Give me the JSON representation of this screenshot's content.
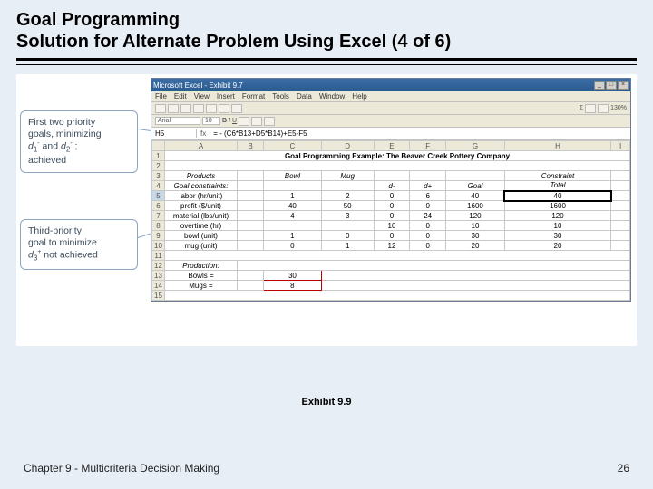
{
  "title_line1": "Goal Programming",
  "title_line2": "Solution for Alternate Problem Using Excel (4 of 6)",
  "excel": {
    "window_title": "Microsoft Excel - Exhibit 9.7",
    "menus": [
      "File",
      "Edit",
      "View",
      "Insert",
      "Format",
      "Tools",
      "Data",
      "Window",
      "Help"
    ],
    "toolbar_font": "Arial",
    "toolbar_size": "10",
    "toolbar_zoom": "130%",
    "namebox": "H5",
    "formula": "= - (C6*B13+D5*B14)+E5-F5",
    "col_headers": [
      "A",
      "B",
      "C",
      "D",
      "E",
      "F",
      "G",
      "H",
      "I"
    ],
    "rows": [
      {
        "n": 1,
        "a_span": "Goal Programming Example: The Beaver Creek Pottery Company"
      },
      {
        "n": 2
      },
      {
        "n": 3,
        "a": "Products",
        "c": "Bowl",
        "d": "Mug",
        "e": "",
        "f": "",
        "g": "",
        "h": "Constraint"
      },
      {
        "n": 4,
        "a": "Goal constraints:",
        "e": "d-",
        "f": "d+",
        "g": "Goal",
        "h": "Total"
      },
      {
        "n": 5,
        "a": "labor (hr/unit)",
        "c": "1",
        "d": "2",
        "e": "0",
        "f": "6",
        "g": "40",
        "h": "40"
      },
      {
        "n": 6,
        "a": "profit ($/unit)",
        "c": "40",
        "d": "50",
        "e": "0",
        "f": "0",
        "g": "1600",
        "h": "1600"
      },
      {
        "n": 7,
        "a": "material (lbs/unit)",
        "c": "4",
        "d": "3",
        "e": "0",
        "f": "24",
        "g": "120",
        "h": "120"
      },
      {
        "n": 8,
        "a": "overtime (hr)",
        "c": "",
        "d": "",
        "e": "10",
        "f": "0",
        "g": "10",
        "h": "10"
      },
      {
        "n": 9,
        "a": "bowl (unit)",
        "c": "1",
        "d": "0",
        "e": "0",
        "f": "0",
        "g": "30",
        "h": "30"
      },
      {
        "n": 10,
        "a": "mug (unit)",
        "c": "0",
        "d": "1",
        "e": "12",
        "f": "0",
        "g": "20",
        "h": "20"
      },
      {
        "n": 11
      },
      {
        "n": 12,
        "a": "Production:"
      },
      {
        "n": 13,
        "a": "Bowls =",
        "c": "30"
      },
      {
        "n": 14,
        "a": "Mugs =",
        "c": "8"
      },
      {
        "n": 15
      }
    ]
  },
  "callout1_l1": "First two priority",
  "callout1_l2": "goals, minimizing",
  "callout1_l3": "d",
  "callout1_sub1": "1",
  "callout1_sup1": "-",
  "callout1_and": " and ",
  "callout1_sub2": "2",
  "callout1_sup2": "-",
  "callout1_l4": "achieved",
  "callout2_l1": "Third-priority",
  "callout2_l2": "goal to minimize",
  "callout2_l3": "d",
  "callout2_sub": "3",
  "callout2_sup": "+",
  "callout2_l4": " not achieved",
  "exhibit_label": "Exhibit 9.9",
  "footer_left": "Chapter 9 - Multicriteria Decision Making",
  "footer_right": "26"
}
